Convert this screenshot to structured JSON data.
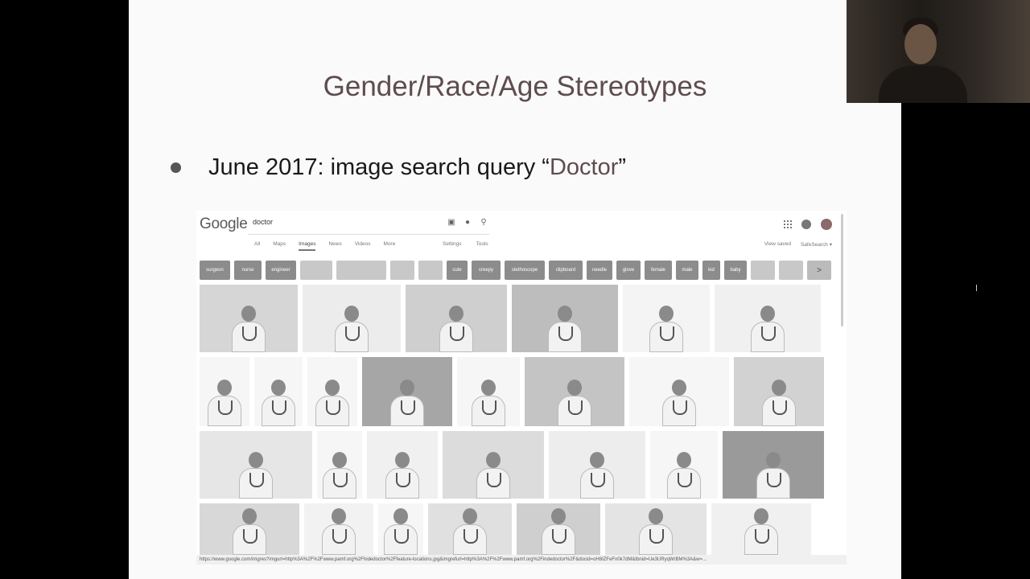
{
  "slide": {
    "title": "Gender/Race/Age Stereotypes",
    "bullet_prefix": "June 2017: image search query “",
    "bullet_query": "Doctor",
    "bullet_suffix": "”"
  },
  "screenshot": {
    "logo": "Google",
    "search": {
      "value": "doctor"
    },
    "nav_tabs": [
      "All",
      "Maps",
      "Images",
      "News",
      "Videos",
      "More"
    ],
    "active_tab": "Images",
    "nav_tools": [
      "Settings",
      "Tools"
    ],
    "nav_right": [
      "View saved",
      "SafeSearch ▾"
    ],
    "chips": [
      "surgeon",
      "nurse",
      "engineer",
      "",
      "",
      "",
      "",
      "cute",
      "creepy",
      "stethoscope",
      "clipboard",
      "needle",
      "glove",
      "female",
      "male",
      "kid",
      "baby",
      "",
      "",
      ">"
    ],
    "status_url": "https://www.google.com/imgres?imgurl=http%3A%2F%2Fwww.pamf.org%2Fhidedoctor%2Ffeature-locations.jpg&imgrefurl=http%3A%2F%2Fwww.pamf.org%2Findedoctor%2F&docid=oH8IZFeFn0k7dM&tbnid=Ue3URyqWrBM%3A&w=..."
  },
  "colors": {
    "title": "#5e4c4f",
    "slide_bg": "#fafafa",
    "chip": "#8c8c8c"
  },
  "icons": [
    "camera-icon",
    "mic-icon",
    "search-icon",
    "apps-icon",
    "notifications-icon",
    "account-avatar"
  ]
}
